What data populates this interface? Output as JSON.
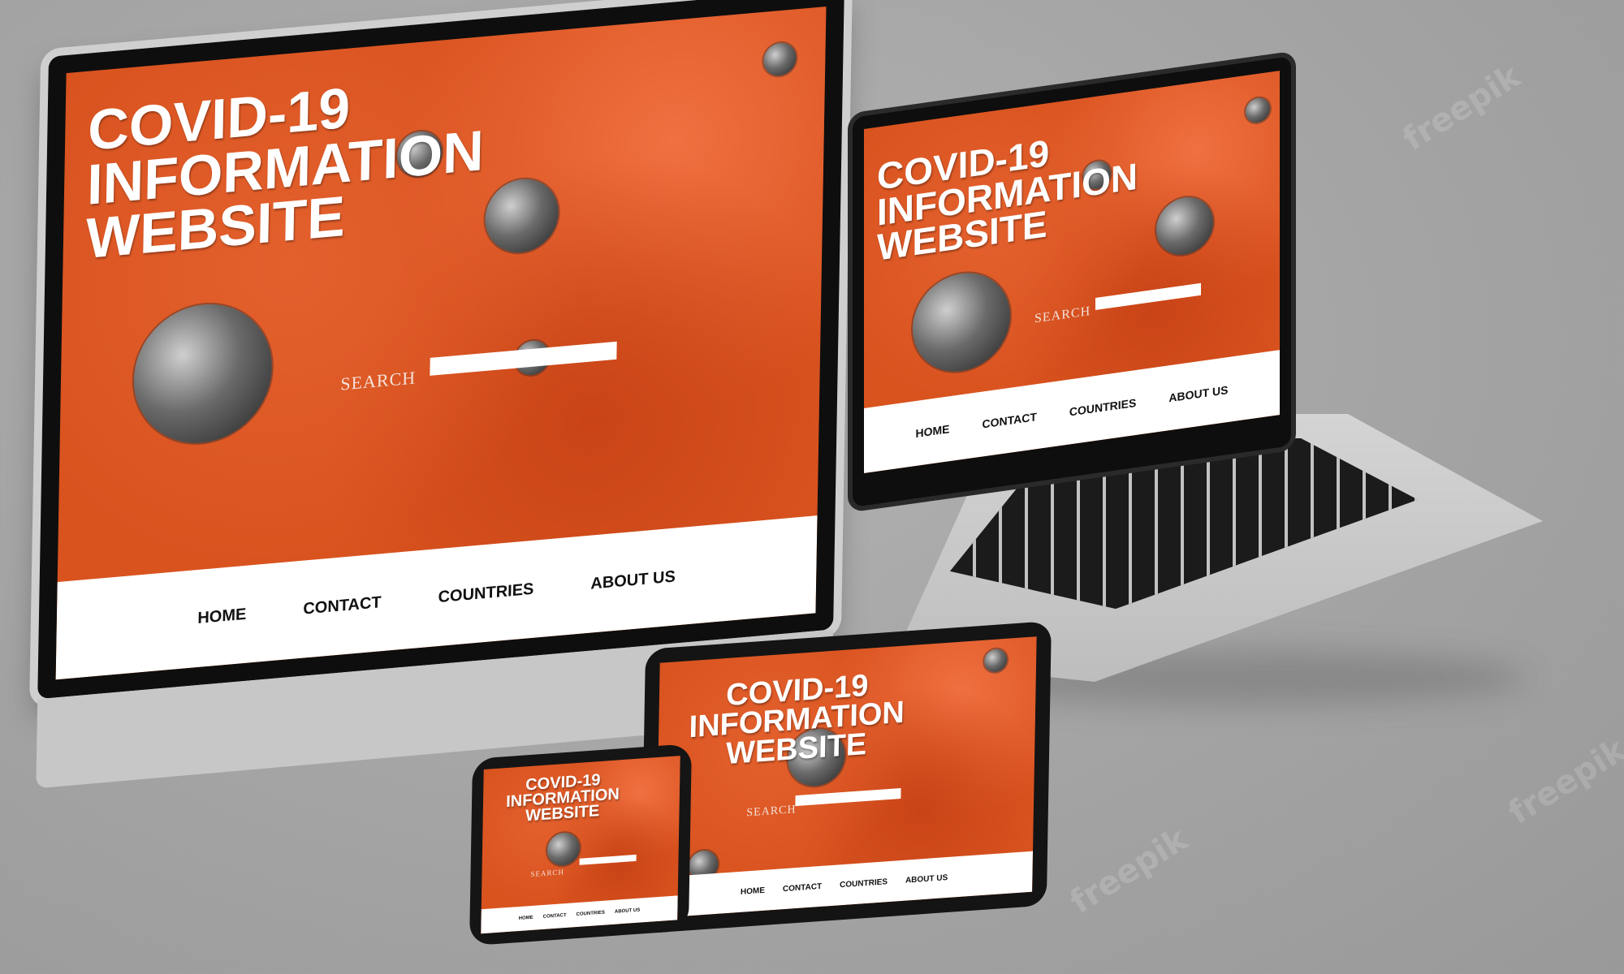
{
  "site": {
    "title_lines": [
      "COVID-19",
      "INFORMATION",
      "WEBSITE"
    ],
    "search_label": "SEARCH",
    "search_value": "",
    "nav": [
      "HOME",
      "CONTACT",
      "COUNTRIES",
      "ABOUT US"
    ]
  },
  "watermark": "freepik",
  "colors": {
    "accent": "#d9531f",
    "background": "#a6a6a6",
    "navbar": "#ffffff",
    "device_frame": "#0e0e0e"
  },
  "icons": [
    "virus-icon"
  ]
}
